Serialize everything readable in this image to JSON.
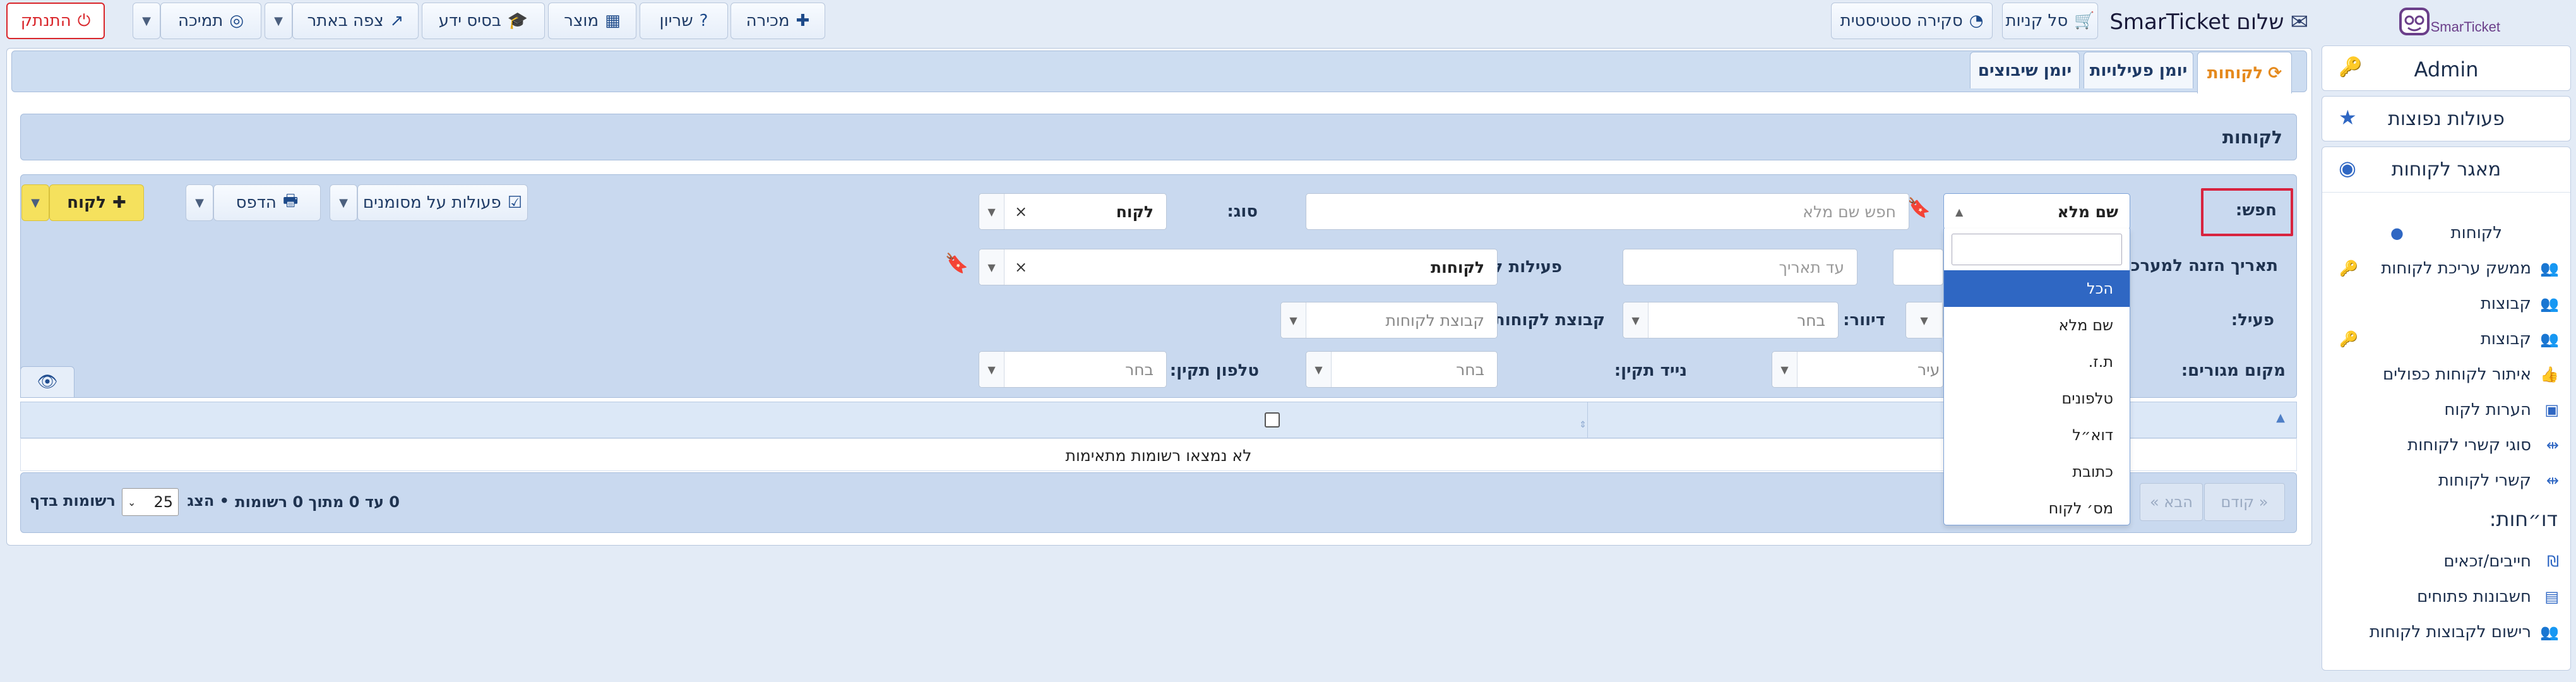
{
  "brand": {
    "logo_text": "SmarTicket",
    "greeting": "שלום SmarTicket"
  },
  "topbar": {
    "logout": "התנתק",
    "support": "תמיכה",
    "view_site": "צפה באתר",
    "knowledge_base": "בסיס ידע",
    "product": "מוצר",
    "reservation": "שריון",
    "sale": "מכירה",
    "cart": "סל קניות",
    "stats_overview": "סקירה סטטיסטית"
  },
  "sidebar": {
    "admin": "Admin",
    "common_actions": "פעולות נפוצות",
    "customer_pool": "מאגר לקוחות",
    "items": [
      {
        "label": "לקוחות"
      },
      {
        "label": "ממשק עריכת לקוחות"
      },
      {
        "label": "קבוצות"
      },
      {
        "label": "קבוצות"
      },
      {
        "label": "איתור לקוחות כפולים"
      },
      {
        "label": "הערות לקוח"
      },
      {
        "label": "סוגי קשרי לקוחות"
      },
      {
        "label": "קשרי לקוחות"
      }
    ],
    "reports_title": "דו״חות:",
    "reports": [
      {
        "label": "חייבים/זכאים"
      },
      {
        "label": "חשבונות פתוחים"
      },
      {
        "label": "רישום לקבוצות לקוחות"
      }
    ]
  },
  "tabs": [
    {
      "label": "לקוחות"
    },
    {
      "label": "יומן פעילויות"
    },
    {
      "label": "יומן שיבוצים"
    }
  ],
  "page_title": "לקוחות",
  "filters": {
    "search_label": "חפש:",
    "search_field_value": "שם מלא",
    "search_placeholder": "חפש שם מלא",
    "type_label": "סוג:",
    "type_value": "לקוח",
    "date_label": "תאריך הזנה למערכת:",
    "to_date_placeholder": "עד תאריך",
    "customer_activities_label": "פעילות לקוח:",
    "customer_activities_value": "לקוחות",
    "active_label": "פעיל:",
    "mailing_label": "דיוור:",
    "mailing_value": "בחר",
    "customer_group_label": "קבוצת לקוחות:",
    "customer_group_placeholder": "קבוצת לקוחות",
    "residence_label": "מקום מגורים:",
    "residence_value": "עיר",
    "valid_mobile_label": "נייד תקין:",
    "valid_mobile_value": "בחר",
    "valid_phone_label": "טלפון תקין:",
    "valid_phone_value": "בחר"
  },
  "dropdown": {
    "options": [
      "הכל",
      "שם מלא",
      "ת.ז.",
      "טלפונים",
      "דוא״ל",
      "כתובת",
      "מס׳ לקוח"
    ],
    "highlighted_index": 0
  },
  "actions": {
    "add_customer": "לקוח",
    "print": "הדפס",
    "selected_actions": "פעולות על מסומנים"
  },
  "table": {
    "empty_message": "לא נמצאו רשומות מתאימות"
  },
  "footer": {
    "prev": "« קודם",
    "next": "הבא »",
    "summary": "0 עד 0 מתוך 0 רשומות",
    "show_label": "• הצג",
    "page_size": "25",
    "per_page_label": "רשומות בדף"
  },
  "colors": {
    "accent": "#2f67c3",
    "logout_red": "#d9262b",
    "highlight_box": "#d8243f",
    "add_button": "#f5e15d",
    "tab_active": "#e58a1e"
  }
}
